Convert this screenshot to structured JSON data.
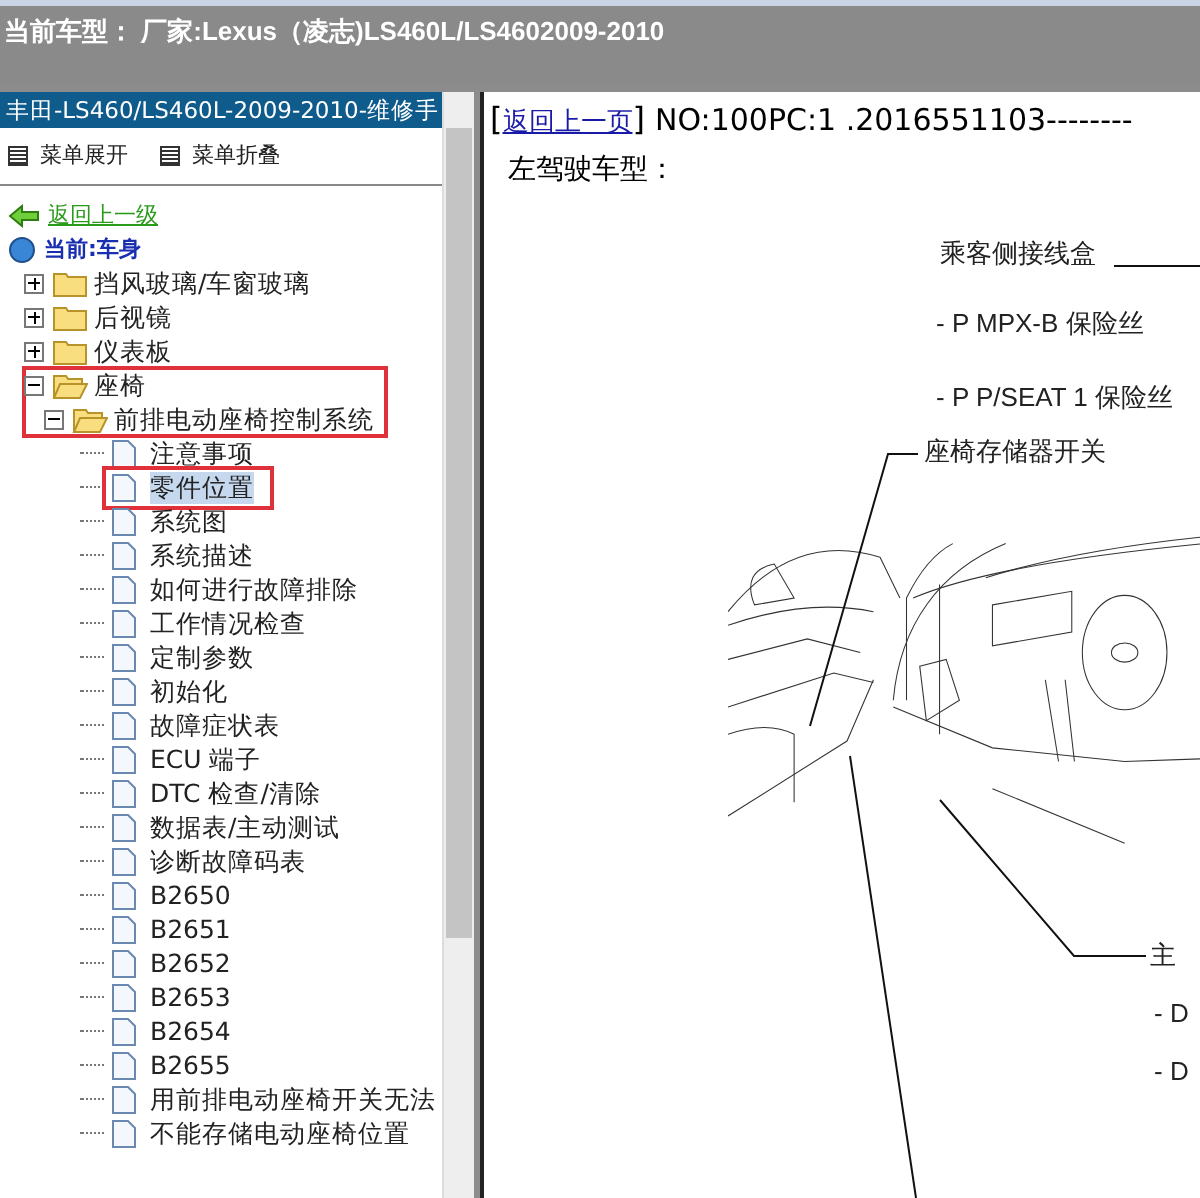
{
  "window": {
    "title": "当前车型： 厂家:Lexus（凌志)LS460L/LS4602009-2010"
  },
  "sidebar": {
    "title": "丰田-LS460/LS460L-2009-2010-维修手",
    "menu_actions": [
      "菜单展开",
      "菜单折叠"
    ],
    "back_link": "返回上一级",
    "current": "当前:车身",
    "tree": [
      {
        "label": "挡风玻璃/车窗玻璃",
        "expanded": false,
        "marked": false
      },
      {
        "label": "后视镜",
        "expanded": false,
        "marked": false
      },
      {
        "label": "仪表板",
        "expanded": false,
        "marked": false
      },
      {
        "label": "座椅",
        "expanded": true,
        "marked": true,
        "children": [
          {
            "label": "前排电动座椅控制系统",
            "expanded": true,
            "children": [
              {
                "label": "注意事项",
                "selected": false,
                "marked": false
              },
              {
                "label": "零件位置",
                "selected": true,
                "marked": true
              },
              {
                "label": "系统图",
                "selected": false,
                "marked": false
              },
              {
                "label": "系统描述",
                "selected": false,
                "marked": false
              },
              {
                "label": "如何进行故障排除",
                "selected": false,
                "marked": false
              },
              {
                "label": "工作情况检查",
                "selected": false,
                "marked": false
              },
              {
                "label": "定制参数",
                "selected": false,
                "marked": false
              },
              {
                "label": "初始化",
                "selected": false,
                "marked": false
              },
              {
                "label": "故障症状表",
                "selected": false,
                "marked": false
              },
              {
                "label": "ECU 端子",
                "selected": false,
                "marked": false
              },
              {
                "label": "DTC 检查/清除",
                "selected": false,
                "marked": false
              },
              {
                "label": "数据表/主动测试",
                "selected": false,
                "marked": false
              },
              {
                "label": "诊断故障码表",
                "selected": false,
                "marked": false
              },
              {
                "label": "B2650",
                "selected": false,
                "marked": false
              },
              {
                "label": "B2651",
                "selected": false,
                "marked": false
              },
              {
                "label": "B2652",
                "selected": false,
                "marked": false
              },
              {
                "label": "B2653",
                "selected": false,
                "marked": false
              },
              {
                "label": "B2654",
                "selected": false,
                "marked": false
              },
              {
                "label": "B2655",
                "selected": false,
                "marked": false
              },
              {
                "label": "用前排电动座椅开关无法",
                "selected": false,
                "marked": false
              },
              {
                "label": "不能存储电动座椅位置",
                "selected": false,
                "marked": false
              }
            ]
          }
        ]
      }
    ]
  },
  "content": {
    "open_bracket": "[",
    "back_link": "返回上一页",
    "close_bracket": "]",
    "doc_number": "NO:100PC:1 .2016551103--------",
    "heading": "左驾驶车型：",
    "callouts": [
      {
        "kind": "title",
        "text": "乘客侧接线盒"
      },
      {
        "kind": "item",
        "text": "- P MPX-B 保险丝"
      },
      {
        "kind": "item",
        "text": "- P P/SEAT 1 保险丝"
      },
      {
        "kind": "title",
        "text": "座椅存储器开关"
      },
      {
        "kind": "title",
        "text": "主"
      },
      {
        "kind": "item",
        "text": "- D"
      },
      {
        "kind": "item",
        "text": "- D"
      }
    ]
  }
}
